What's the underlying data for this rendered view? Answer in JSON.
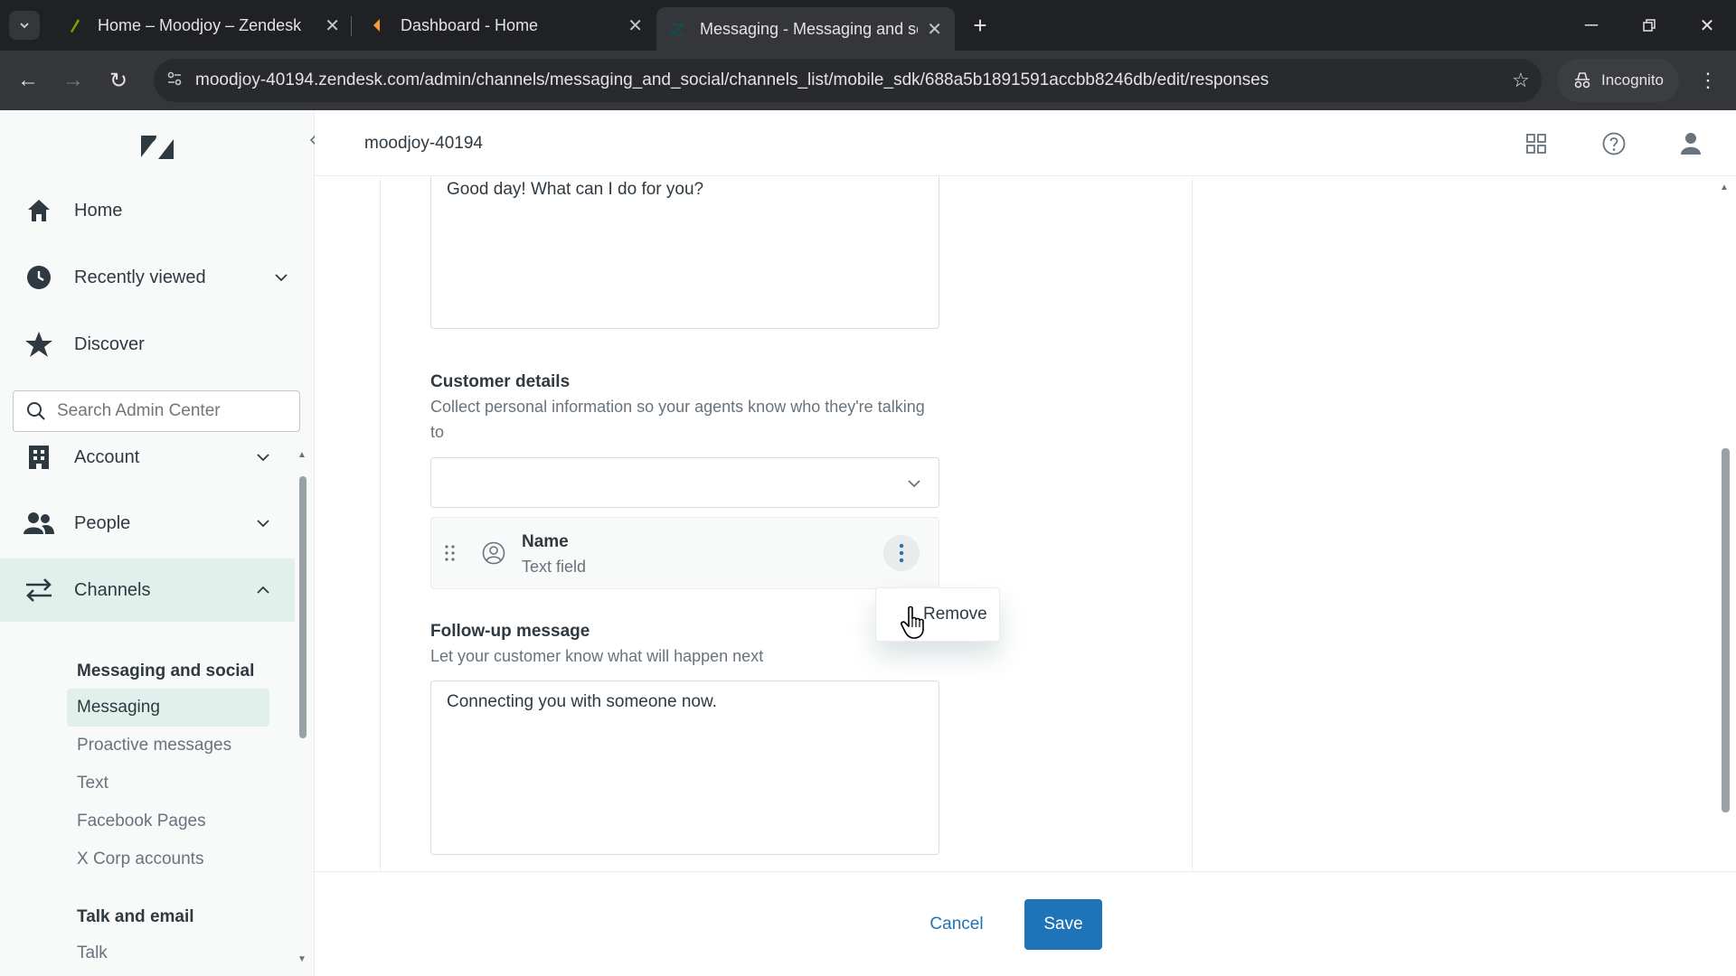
{
  "browser": {
    "tabs": [
      {
        "title": "Home – Moodjoy – Zendesk",
        "favicon_color": "#78a300"
      },
      {
        "title": "Dashboard - Home",
        "favicon_color": "#f79a3e"
      },
      {
        "title": "Messaging - Messaging and so",
        "favicon_color": "#03363d"
      }
    ],
    "url": "moodjoy-40194.zendesk.com/admin/channels/messaging_and_social/channels_list/mobile_sdk/688a5b1891591accbb8246db/edit/responses",
    "incognito_label": "Incognito"
  },
  "header": {
    "account_name": "moodjoy-40194"
  },
  "sidebar": {
    "nav": [
      {
        "label": "Home",
        "icon": "home-icon"
      },
      {
        "label": "Recently viewed",
        "icon": "clock-icon"
      },
      {
        "label": "Discover",
        "icon": "star-icon"
      },
      {
        "label": "Account",
        "icon": "building-icon"
      },
      {
        "label": "People",
        "icon": "people-icon"
      },
      {
        "label": "Channels",
        "icon": "channels-icon"
      }
    ],
    "search_placeholder": "Search Admin Center",
    "sections": [
      {
        "heading": "Messaging and social",
        "items": [
          "Messaging",
          "Proactive messages",
          "Text",
          "Facebook Pages",
          "X Corp accounts"
        ]
      },
      {
        "heading": "Talk and email",
        "items": [
          "Talk"
        ]
      }
    ]
  },
  "form": {
    "greeting_text": "Good day! What can I do for you?",
    "customer_details": {
      "label": "Customer details",
      "hint": "Collect personal information so your agents know who they're talking to",
      "select_value": "",
      "fields": [
        {
          "name": "Name",
          "type": "Text field"
        }
      ]
    },
    "menu": {
      "remove_label": "Remove"
    },
    "followup": {
      "label": "Follow-up message",
      "hint": "Let your customer know what will happen next",
      "text": "Connecting you with someone now."
    }
  },
  "footer": {
    "cancel_label": "Cancel",
    "save_label": "Save"
  },
  "colors": {
    "accent": "#1f73b7",
    "active_nav_bg": "#e2f0ec",
    "brand_dark": "#03363d"
  }
}
